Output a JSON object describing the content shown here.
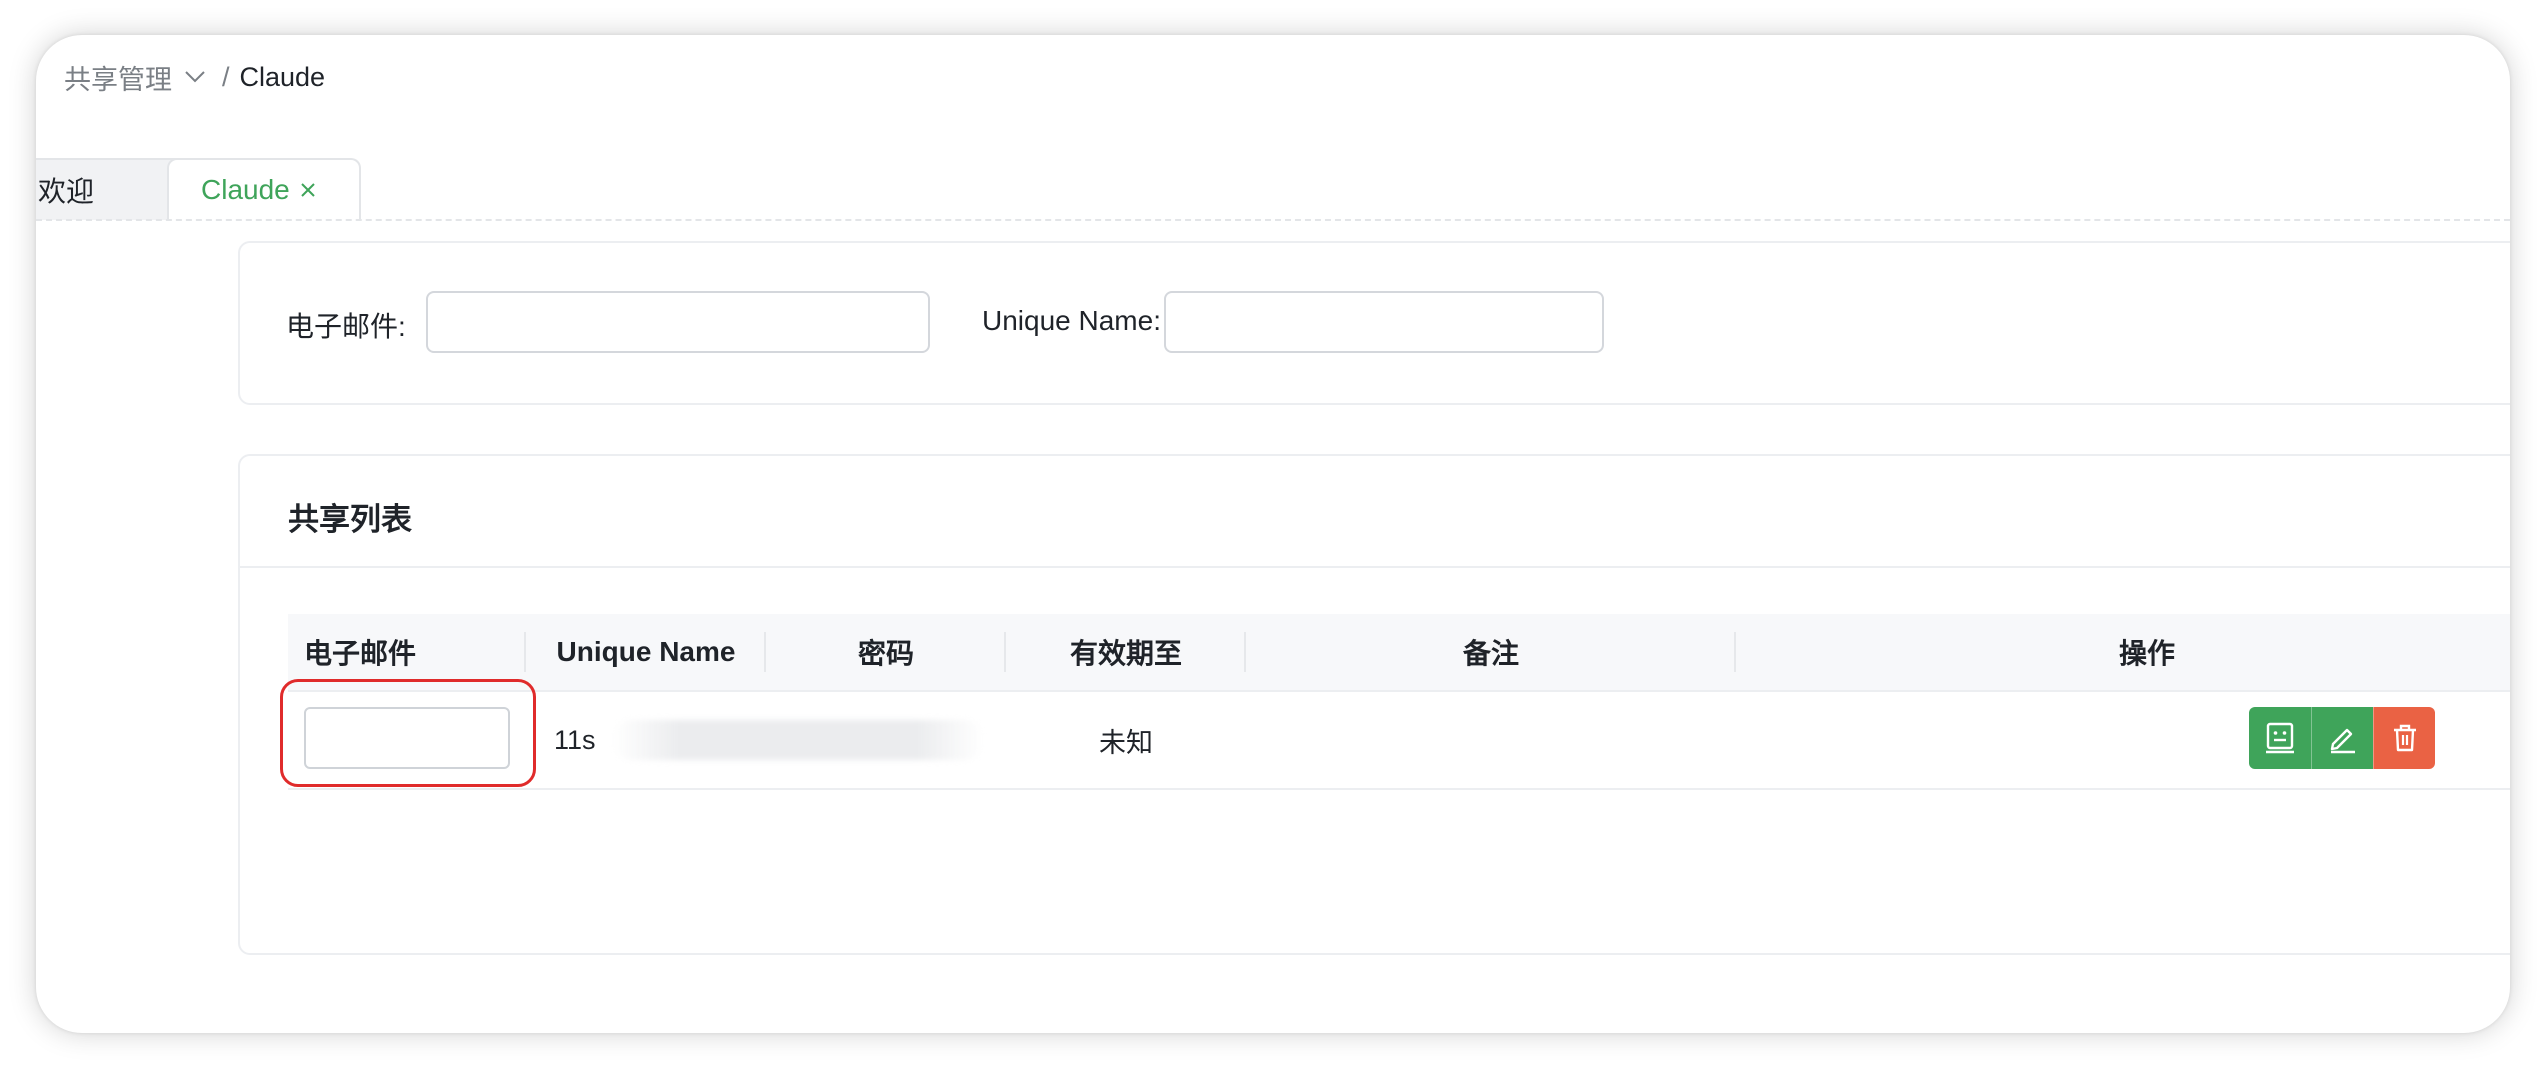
{
  "breadcrumb": {
    "parent": "共享管理",
    "separator": "/",
    "current": "Claude"
  },
  "tabs": [
    {
      "label": "欢迎",
      "active": false
    },
    {
      "label": "Claude",
      "active": true,
      "closable": true
    }
  ],
  "search": {
    "email_label": "电子邮件:",
    "email_value": "",
    "unique_name_label": "Unique Name:",
    "unique_name_value": ""
  },
  "list": {
    "title": "共享列表",
    "columns": [
      "电子邮件",
      "Unique Name",
      "密码",
      "有效期至",
      "备注",
      "操作"
    ],
    "rows": [
      {
        "email": "",
        "unique_name": "11s",
        "password": "",
        "expires": "未知",
        "note": "",
        "actions": [
          "face-icon",
          "edit-icon",
          "trash-icon"
        ]
      }
    ]
  },
  "colors": {
    "accent": "#3fa45a",
    "danger": "#ea6244",
    "highlight": "#e02b2b"
  }
}
